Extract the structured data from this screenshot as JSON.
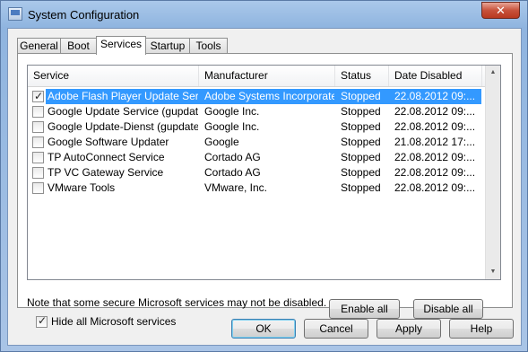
{
  "window": {
    "title": "System Configuration",
    "close_symbol": "✕"
  },
  "tabs": [
    {
      "label": "General"
    },
    {
      "label": "Boot"
    },
    {
      "label": "Services"
    },
    {
      "label": "Startup"
    },
    {
      "label": "Tools"
    }
  ],
  "active_tab": "Services",
  "table": {
    "columns": [
      "Service",
      "Manufacturer",
      "Status",
      "Date Disabled"
    ],
    "rows": [
      {
        "checked": true,
        "service": "Adobe Flash Player Update Service",
        "manufacturer": "Adobe Systems Incorporated",
        "status": "Stopped",
        "date": "22.08.2012 09:...",
        "selected": true
      },
      {
        "checked": false,
        "service": "Google Update Service (gupdate)",
        "manufacturer": "Google Inc.",
        "status": "Stopped",
        "date": "22.08.2012 09:..."
      },
      {
        "checked": false,
        "service": "Google Update-Dienst (gupdatem)",
        "manufacturer": "Google Inc.",
        "status": "Stopped",
        "date": "22.08.2012 09:..."
      },
      {
        "checked": false,
        "service": "Google Software Updater",
        "manufacturer": "Google",
        "status": "Stopped",
        "date": "21.08.2012 17:..."
      },
      {
        "checked": false,
        "service": "TP AutoConnect Service",
        "manufacturer": "Cortado AG",
        "status": "Stopped",
        "date": "22.08.2012 09:..."
      },
      {
        "checked": false,
        "service": "TP VC Gateway Service",
        "manufacturer": "Cortado AG",
        "status": "Stopped",
        "date": "22.08.2012 09:..."
      },
      {
        "checked": false,
        "service": "VMware Tools",
        "manufacturer": "VMware, Inc.",
        "status": "Stopped",
        "date": "22.08.2012 09:..."
      }
    ]
  },
  "note": "Note that some secure Microsoft services may not be disabled.",
  "buttons": {
    "enable_all": "Enable all",
    "disable_all": "Disable all",
    "ok": "OK",
    "cancel": "Cancel",
    "apply": "Apply",
    "help": "Help"
  },
  "hide_ms": {
    "label": "Hide all Microsoft services",
    "checked": true
  },
  "colors": {
    "selection": "#3399ff",
    "close_button": "#c8523b",
    "frame": "#a9c4e6"
  }
}
